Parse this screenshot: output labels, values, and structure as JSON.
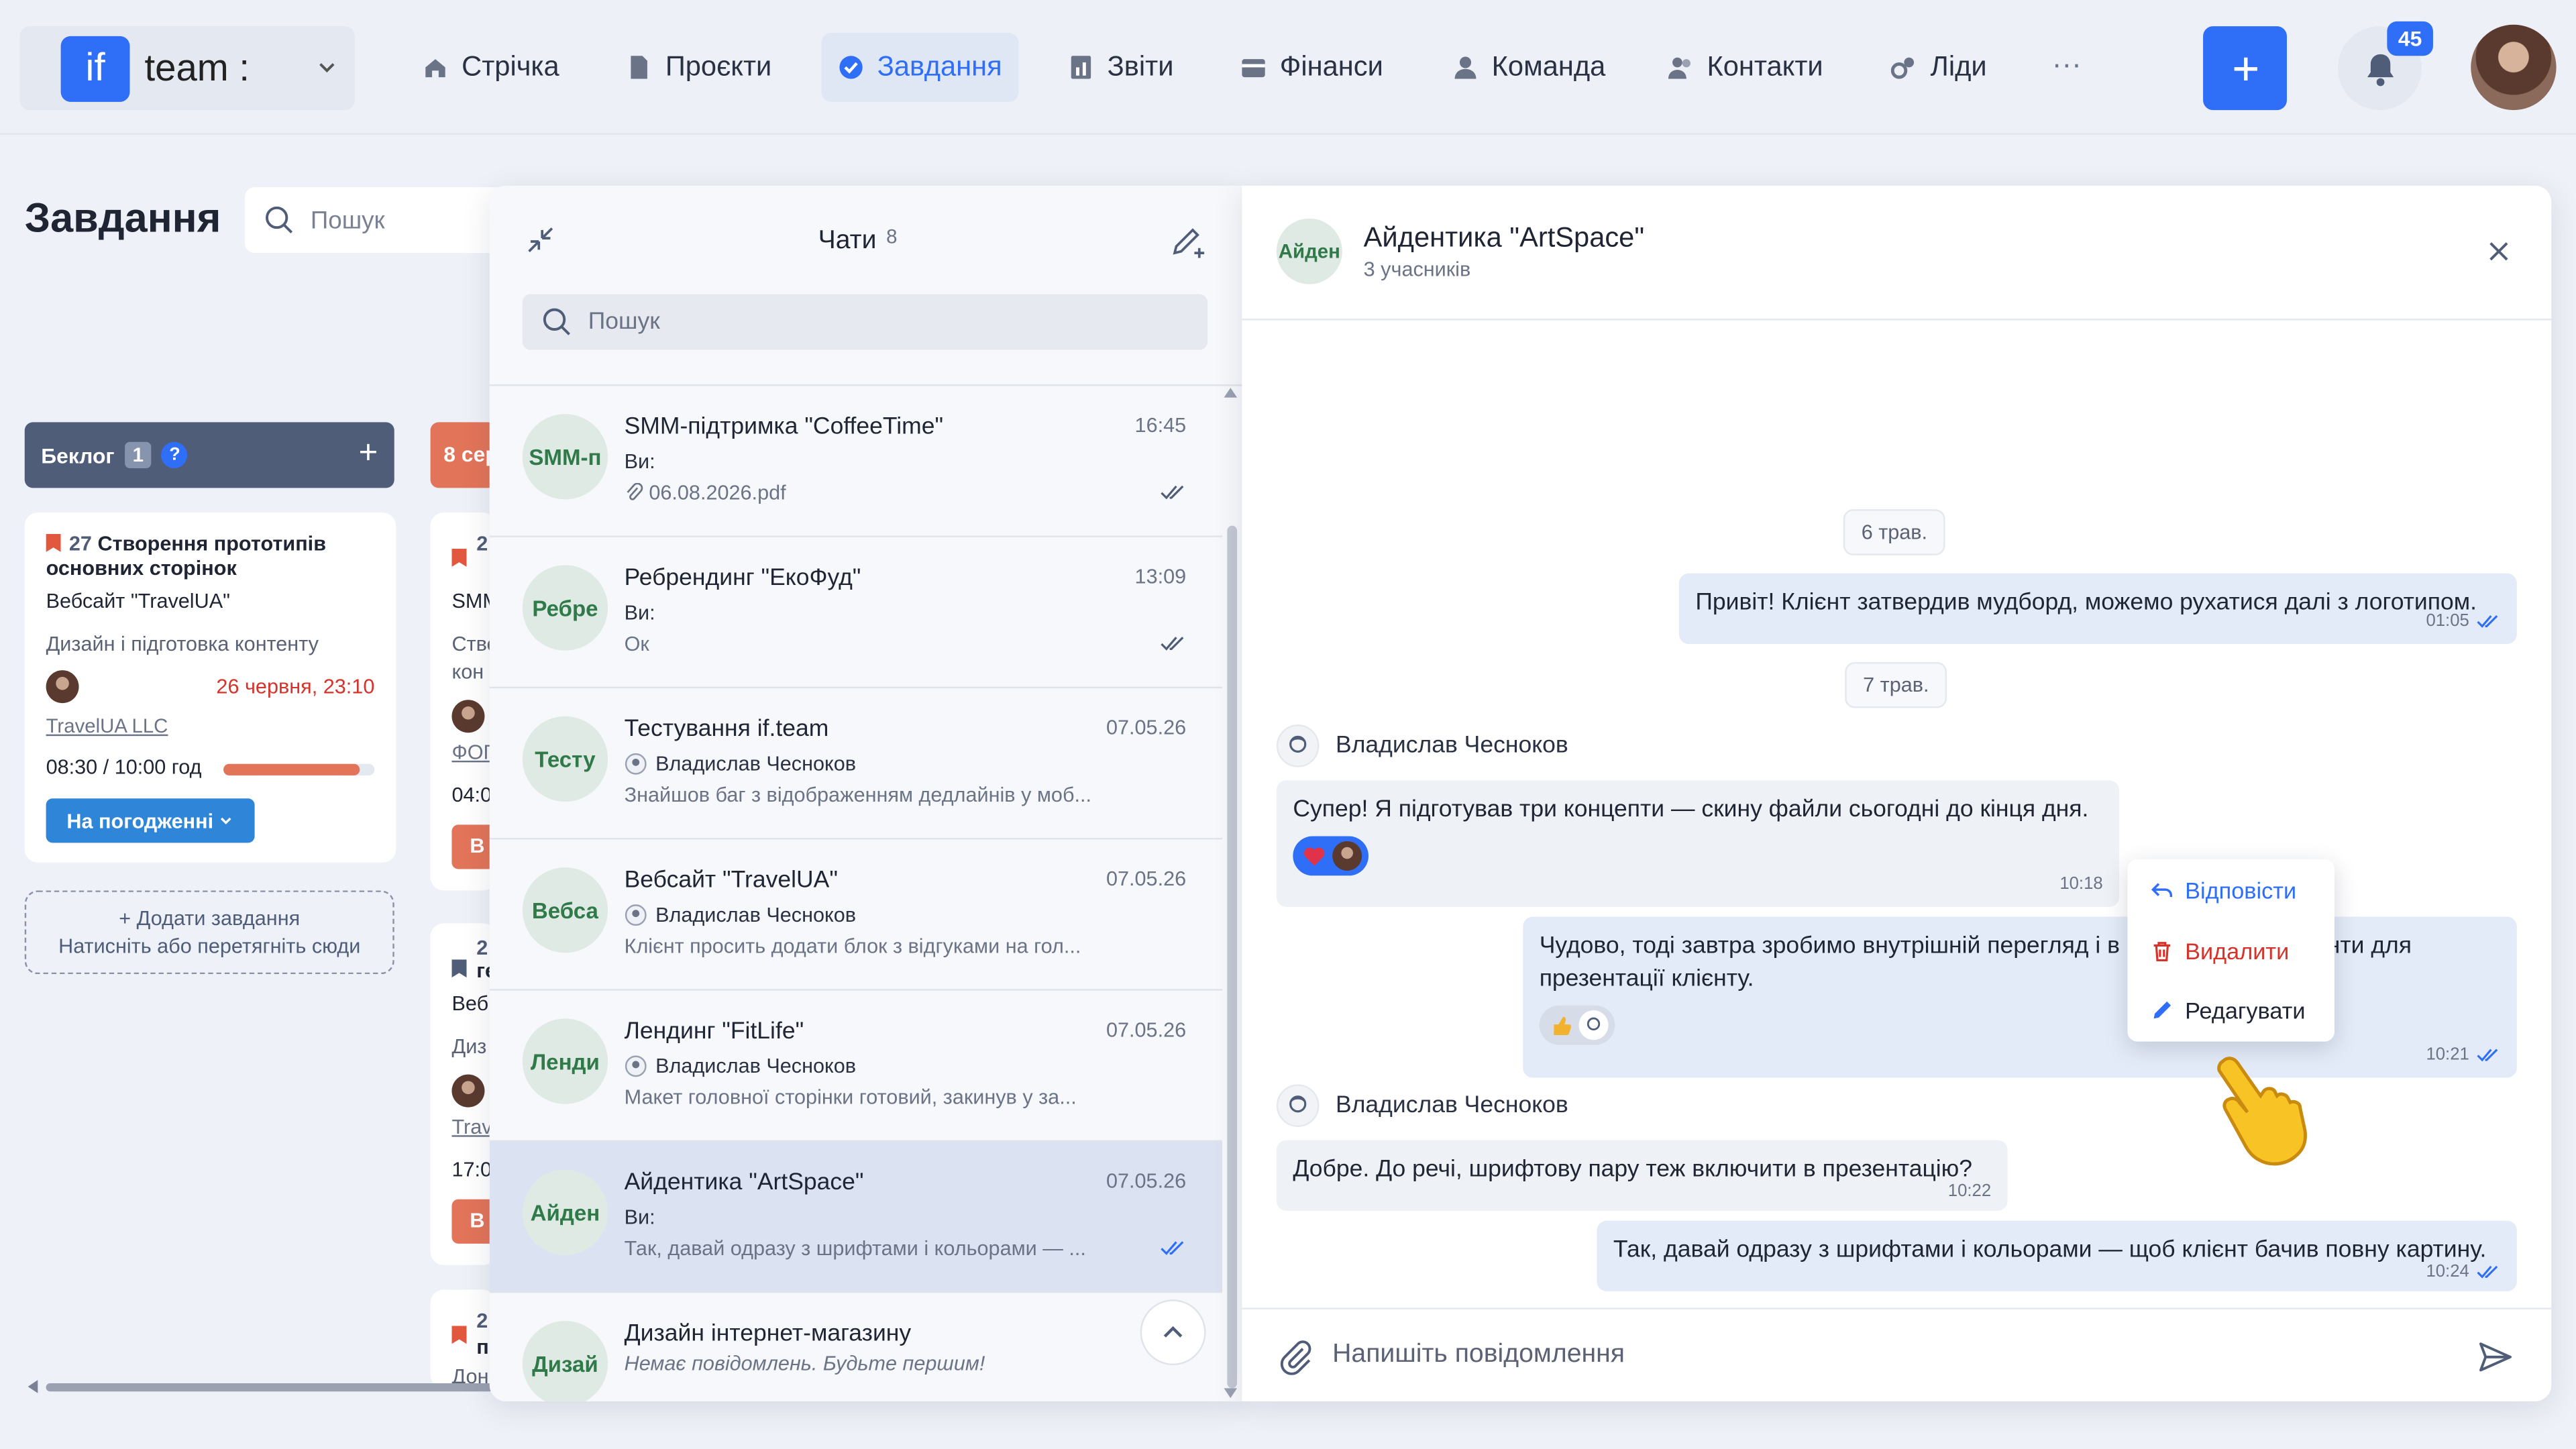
{
  "app": {
    "logo_mark": "if",
    "logo_text": "team :"
  },
  "nav": {
    "items": [
      {
        "label": "Стрічка",
        "icon": "home-icon"
      },
      {
        "label": "Проєкти",
        "icon": "file-icon"
      },
      {
        "label": "Завдання",
        "icon": "check-circle-icon",
        "active": true
      },
      {
        "label": "Звіти",
        "icon": "report-icon"
      },
      {
        "label": "Фінанси",
        "icon": "wallet-icon"
      },
      {
        "label": "Команда",
        "icon": "user-icon"
      },
      {
        "label": "Контакти",
        "icon": "contacts-icon"
      },
      {
        "label": "Ліди",
        "icon": "leads-icon"
      }
    ],
    "more": "···",
    "add": "+",
    "notifications": "45"
  },
  "board": {
    "title": "Завдання",
    "search_placeholder": "Пошук",
    "column": {
      "name": "Беклог",
      "count": "1",
      "help": "?",
      "add": "+"
    },
    "column2_name": "8 сер",
    "card": {
      "number": "27",
      "title": "Створення прототипів основних сторінок",
      "project": "Вебсайт \"TravelUA\"",
      "stage": "Дизайн і підготовка контенту",
      "deadline": "26 червня, 23:10",
      "client": "TravelUA LLC",
      "time": "08:30 / 10:00 год",
      "progress": 0.9,
      "status": "На погодженні"
    },
    "add_task": {
      "line1": "+ Додати завдання",
      "line2": "Натисніть або перетягніть сюди"
    },
    "side_cards": {
      "c1_line1": "2",
      "c1_line2": "SMM",
      "c1_line3": "Стве",
      "c1_line4": "кон",
      "c1_line5": "ФОП",
      "c1_line6": "04:0",
      "c1_line7": "В",
      "c2_line1": "2",
      "c2_line2": "ге",
      "c2_line3": "Веб",
      "c2_line4": "Диз",
      "c2_line5": "Trav",
      "c2_line6": "17:0",
      "c2_line7": "В",
      "c3_line1": "2",
      "c3_line2": "п",
      "c3_line3": "Дон"
    }
  },
  "colors": {
    "accent": "#2f6ef7",
    "danger": "#d6332b",
    "progress": "#e2745a",
    "status": "#2f86d8",
    "avatar_text": "#2f7a48"
  },
  "chats": {
    "title": "Чати",
    "count": "8",
    "search_placeholder": "Пошук",
    "items": [
      {
        "avatar": "SMM-п",
        "name": "SMM-підтримка \"CoffeeTime\"",
        "time": "16:45",
        "who": "Ви:",
        "preview": "06.08.2026.pdf"
      },
      {
        "avatar": "Ребре",
        "name": "Ребрендинг \"ЕкоФуд\"",
        "time": "13:09",
        "who": "Ви:",
        "preview": "Ок"
      },
      {
        "avatar": "Тесту",
        "name": "Тестування if.team",
        "time": "07.05.26",
        "who": "Владислав Чесноков",
        "preview": "Знайшов баг з відображенням дедлайнів у моб..."
      },
      {
        "avatar": "Вебса",
        "name": "Вебсайт \"TravelUA\"",
        "time": "07.05.26",
        "who": "Владислав Чесноков",
        "preview": "Клієнт просить додати блок з відгуками на гол..."
      },
      {
        "avatar": "Ленди",
        "name": "Лендинг \"FitLife\"",
        "time": "07.05.26",
        "who": "Владислав Чесноков",
        "preview": "Макет головної сторінки готовий, закинув у за..."
      },
      {
        "avatar": "Айден",
        "name": "Айдентика \"ArtSpace\"",
        "time": "07.05.26",
        "who": "Ви:",
        "preview": "Так, давай одразу з шрифтами і кольорами — ..."
      },
      {
        "avatar": "Дизай",
        "name": "Дизайн інтернет-магазину",
        "time": "",
        "who": "",
        "preview": "Немає повідомлень. Будьте першим!"
      }
    ]
  },
  "conversation": {
    "avatar": "Айден",
    "title": "Айдентика \"ArtSpace\"",
    "subtitle": "3 учасників",
    "date1": "6 трав.",
    "date2": "7 трав.",
    "messages": [
      {
        "text": "Привіт! Клієнт затвердив мудборд, можемо рухатися далі з логотипом.",
        "time": "01:05"
      },
      {
        "sender": "Владислав Чесноков",
        "text": "Супер! Я підготував три концепти — скину файли сьогодні до кінця дня.",
        "time": "10:18"
      },
      {
        "text_a": "Чудово, тоді завтра зробимо внутрішній перегляд і в",
        "text_b": "анти для",
        "text_c": "презентації клієнту.",
        "time": "10:21"
      },
      {
        "sender": "Владислав Чесноков",
        "text": "Добре. До речі, шрифтову пару теж включити в презентацію?",
        "time": "10:22"
      },
      {
        "text": "Так, давай одразу з шрифтами і кольорами — щоб клієнт бачив повну картину.",
        "time": "10:24"
      }
    ],
    "composer_placeholder": "Напишіть повідомлення"
  },
  "context_menu": {
    "reply": "Відповісти",
    "delete": "Видалити",
    "edit": "Редагувати"
  }
}
